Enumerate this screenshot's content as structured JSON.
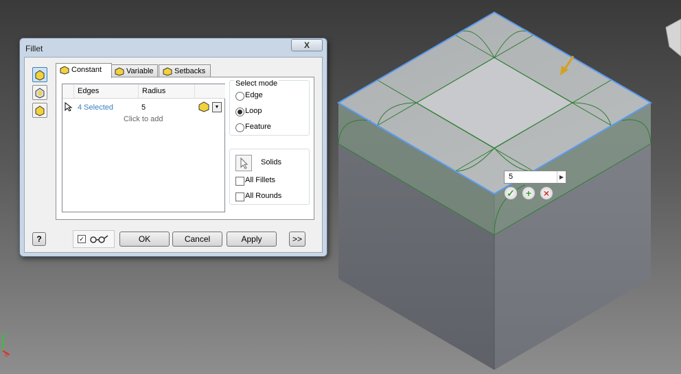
{
  "dialog": {
    "title": "Fillet",
    "close_label": "X",
    "tabs": [
      {
        "label": "Constant",
        "active": true
      },
      {
        "label": "Variable",
        "active": false
      },
      {
        "label": "Setbacks",
        "active": false
      }
    ],
    "table": {
      "columns": [
        "Edges",
        "Radius"
      ],
      "rows": [
        {
          "edges": "4 Selected",
          "radius": "5"
        }
      ],
      "add_row_hint": "Click to add"
    },
    "select_mode": {
      "title": "Select mode",
      "options": [
        {
          "label": "Edge",
          "selected": false
        },
        {
          "label": "Loop",
          "selected": true
        },
        {
          "label": "Feature",
          "selected": false
        }
      ]
    },
    "solids": {
      "label": "Solids",
      "all_fillets": "All Fillets",
      "all_rounds": "All Rounds"
    },
    "buttons": {
      "help": "?",
      "ok": "OK",
      "cancel": "Cancel",
      "apply": "Apply",
      "more": ">>"
    }
  },
  "viewport": {
    "radius_input_value": "5",
    "axis_labels": {
      "x": "X",
      "y": "Y"
    }
  },
  "colors": {
    "edge_highlight": "#5b9bf0",
    "fillet_preview": "#2e7d32",
    "selected_link": "#3a7fc1",
    "arrow": "#d4a020"
  }
}
